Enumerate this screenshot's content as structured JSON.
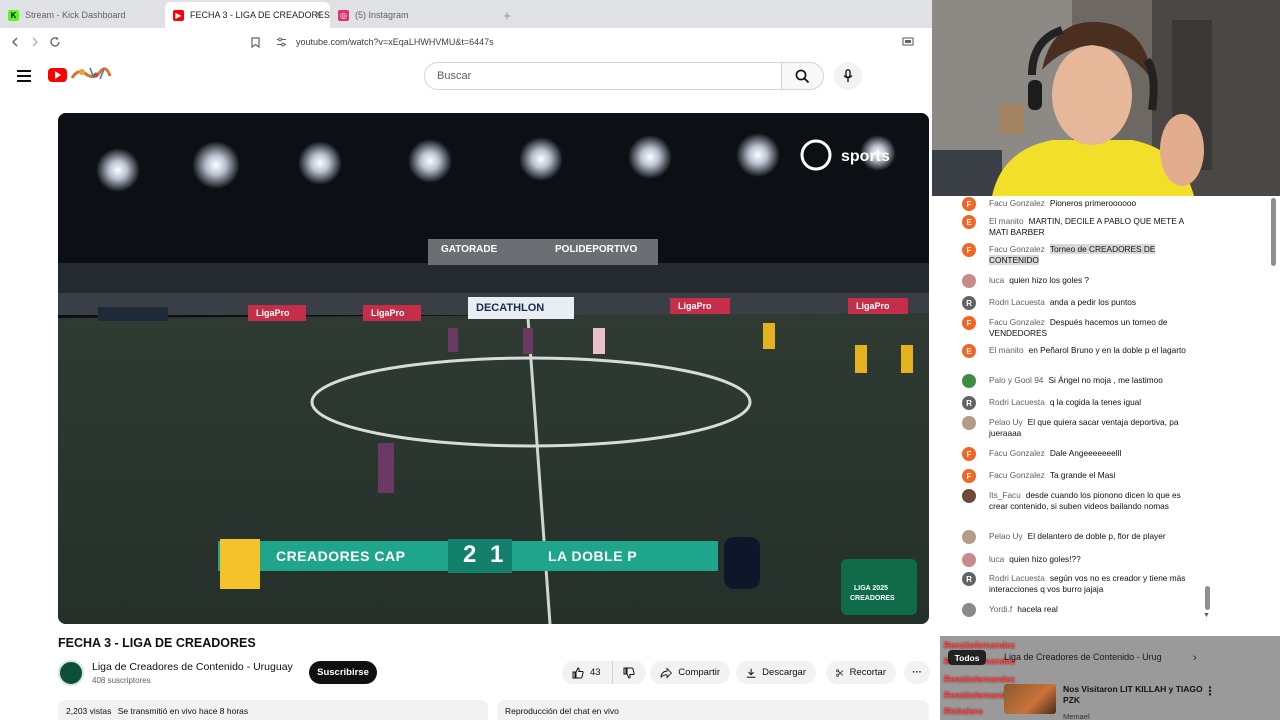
{
  "browser": {
    "tabs": [
      {
        "label": "Stream - Kick Dashboard",
        "active": false,
        "favicon_color": "#53fc18",
        "favicon_glyph": "K"
      },
      {
        "label": "FECHA 3 - LIGA DE CREADORES",
        "active": true,
        "favicon_color": "#ff0000",
        "favicon_glyph": "▶"
      },
      {
        "label": "(5) Instagram",
        "active": false,
        "favicon_color": "#e1306c",
        "favicon_glyph": "◎"
      }
    ],
    "new_tab_glyph": "+",
    "close_glyph": "×",
    "url": "youtube.com/watch?v=xEqaLHWHVMU&t=6447s",
    "nav_icons": [
      "back-icon",
      "forward-icon",
      "reload-icon",
      "bookmark-icon",
      "site-info-icon",
      "cast-icon"
    ]
  },
  "header": {
    "search_placeholder": "Buscar",
    "icons": [
      "menu-icon",
      "youtube-logo-icon",
      "search-icon",
      "microphone-icon"
    ]
  },
  "video": {
    "team_home": "CREADORES CAP",
    "team_away": "LA DOBLE P",
    "score_home": "2",
    "score_away": "1",
    "broadcaster": "sports",
    "league_badge": [
      "LIGA 2025",
      "CREADORES"
    ],
    "boards": [
      "GATORADE",
      "POLIDEPORTIVO",
      "DECATHLON",
      "LigaPro",
      "LigaPro",
      "LigaPro",
      "LigaPro"
    ]
  },
  "meta": {
    "title": "FECHA 3 - LIGA DE CREADORES",
    "channel": "Liga de Creadores de Contenido - Uruguay",
    "subscribers": "408 suscriptores",
    "subscribe_label": "Suscribirse",
    "likes": "43",
    "share_label": "Compartir",
    "download_label": "Descargar",
    "clip_label": "Recortar",
    "more_glyph": "···",
    "views": "2,203 vistas",
    "streamed": "Se transmitió en vivo hace 8 horas",
    "chat_replay": "Reproducción del chat en vivo"
  },
  "chat": {
    "messages": [
      {
        "author": "Facu Gonzalez",
        "text": "Pioneros primeroooooo",
        "initial": "F",
        "color": "#f26522",
        "highlight": false
      },
      {
        "author": "El manito",
        "text": "MARTIN, DECILE A PABLO QUE METE A MATI BARBER",
        "initial": "E",
        "color": "#f26522",
        "highlight": false
      },
      {
        "author": "Facu Gonzalez",
        "text": "Torneo de CREADORES DE CONTENIDO",
        "initial": "F",
        "color": "#f26522",
        "highlight": true
      },
      {
        "author": "luca",
        "text": "quien hizo los goles ?",
        "initial": "",
        "color": "#c98a8a",
        "highlight": false
      },
      {
        "author": "Rodri Lacuesta",
        "text": "anda a pedir los puntos",
        "initial": "R",
        "color": "#5f6368",
        "highlight": false
      },
      {
        "author": "Facu Gonzalez",
        "text": "Después hacemos un torneo de VENDEDORES",
        "initial": "F",
        "color": "#f26522",
        "highlight": false
      },
      {
        "author": "El manito",
        "text": "en Peñarol Bruno y en la doble p el lagarto",
        "initial": "E",
        "color": "#f26522",
        "highlight": false
      },
      {
        "author": "Palo y Gool 94",
        "text": "Si Ángel no moja , me lastimoo",
        "initial": "",
        "color": "#3e8e41",
        "highlight": false
      },
      {
        "author": "Rodri Lacuesta",
        "text": "q la cogida la tenes igual",
        "initial": "R",
        "color": "#5f6368",
        "highlight": false
      },
      {
        "author": "Pelao Uy",
        "text": "El que quiera sacar ventaja deportiva, pa jueraaaa",
        "initial": "",
        "color": "#b59a8a",
        "highlight": false
      },
      {
        "author": "Facu Gonzalez",
        "text": "Dale Angeeeeeeelll",
        "initial": "F",
        "color": "#f26522",
        "highlight": false
      },
      {
        "author": "Facu Gonzalez",
        "text": "Ta grande el Masi",
        "initial": "F",
        "color": "#f26522",
        "highlight": false
      },
      {
        "author": "Its_Facu",
        "text": "desde cuando los pionono dicen lo que es crear contenido, si suben videos bailando nomas",
        "initial": "",
        "color": "#6b4a3a",
        "highlight": false
      },
      {
        "author": "Pelao Uy",
        "text": "El delantero de doble p, flor de player",
        "initial": "",
        "color": "#b59a8a",
        "highlight": false
      },
      {
        "author": "luca",
        "text": "quien hizo goles!??",
        "initial": "",
        "color": "#c98a8a",
        "highlight": false
      },
      {
        "author": "Rodri Lacuesta",
        "text": "según vos no es creador y tiene más interacciones q vos burro jajaja",
        "initial": "R",
        "color": "#5f6368",
        "highlight": false
      },
      {
        "author": "Yordi.f",
        "text": "hacela real",
        "initial": "",
        "color": "#8a8a8a",
        "highlight": false
      }
    ]
  },
  "overlay": {
    "chat_names": [
      "Renzitofernandez",
      "Renzitofernandez",
      "Renzitofernandez",
      "Renzitofernandez",
      "Richalero"
    ],
    "filter_label": "Todos",
    "playlist_channel": "Liga de Creadores de Contenido - Urug",
    "video_title": "Nos Visitaron LIT KILLAH y TIAGO PZK",
    "video_channel": "Memael"
  }
}
